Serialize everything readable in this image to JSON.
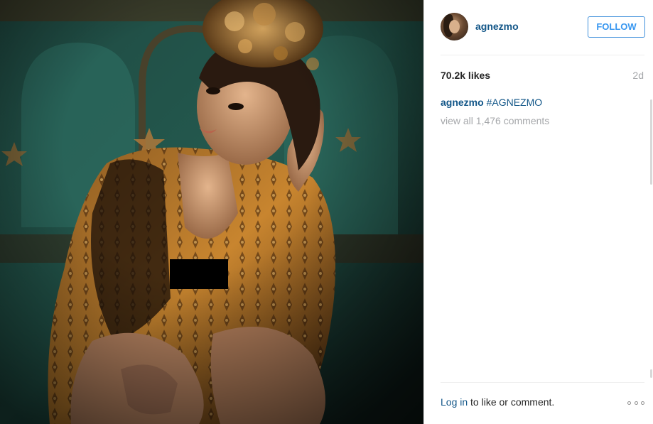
{
  "post": {
    "username": "agnezmo",
    "follow_label": "FOLLOW",
    "likes": "70.2k likes",
    "time": "2d",
    "caption": {
      "user": "agnezmo",
      "text": "#AGNEZMO"
    },
    "view_comments": "view all 1,476 comments",
    "footer": {
      "login_label": "Log in",
      "login_suffix": " to like or comment."
    },
    "colors": {
      "link": "#125688",
      "follow": "#3897f0",
      "muted": "#a5a7aa"
    },
    "icons": {
      "more": "more-options-icon"
    }
  }
}
